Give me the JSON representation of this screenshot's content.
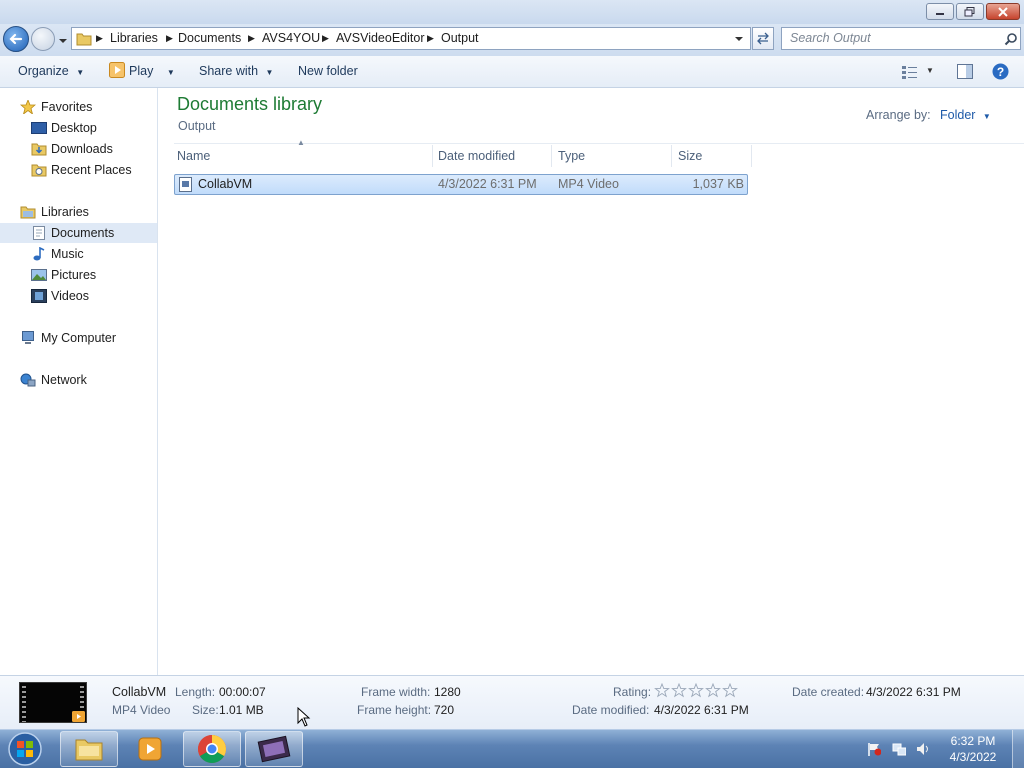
{
  "window": {
    "address": {
      "crumbs": [
        "Libraries",
        "Documents",
        "AVS4YOU",
        "AVSVideoEditor",
        "Output"
      ]
    },
    "search_placeholder": "Search Output"
  },
  "toolbar": {
    "organize": "Organize",
    "play": "Play",
    "share_with": "Share with",
    "new_folder": "New folder"
  },
  "navpane": {
    "favorites": "Favorites",
    "favorites_items": [
      "Desktop",
      "Downloads",
      "Recent Places"
    ],
    "libraries": "Libraries",
    "libraries_items": [
      "Documents",
      "Music",
      "Pictures",
      "Videos"
    ],
    "my_computer": "My Computer",
    "network": "Network"
  },
  "library": {
    "title": "Documents library",
    "subtitle": "Output",
    "arrange_label": "Arrange by:",
    "arrange_value": "Folder"
  },
  "columns": [
    "Name",
    "Date modified",
    "Type",
    "Size"
  ],
  "files": [
    {
      "name": "CollabVM",
      "date_modified": "4/3/2022 6:31 PM",
      "type": "MP4 Video",
      "size": "1,037 KB"
    }
  ],
  "details": {
    "name": "CollabVM",
    "type": "MP4 Video",
    "length_label": "Length:",
    "length": "00:00:07",
    "size_label": "Size:",
    "size": "1.01 MB",
    "frame_width_label": "Frame width:",
    "frame_width": "1280",
    "frame_height_label": "Frame height:",
    "frame_height": "720",
    "rating_label": "Rating:",
    "rating_stars": 0,
    "date_modified_label": "Date modified:",
    "date_modified": "4/3/2022 6:31 PM",
    "date_created_label": "Date created:",
    "date_created": "4/3/2022 6:31 PM"
  },
  "taskbar": {
    "clock_time": "6:32 PM",
    "clock_date": "4/3/2022"
  },
  "colors": {
    "accent_green": "#1e7b34",
    "link_blue": "#1e5aa8",
    "selection": "#c1dcfb"
  }
}
